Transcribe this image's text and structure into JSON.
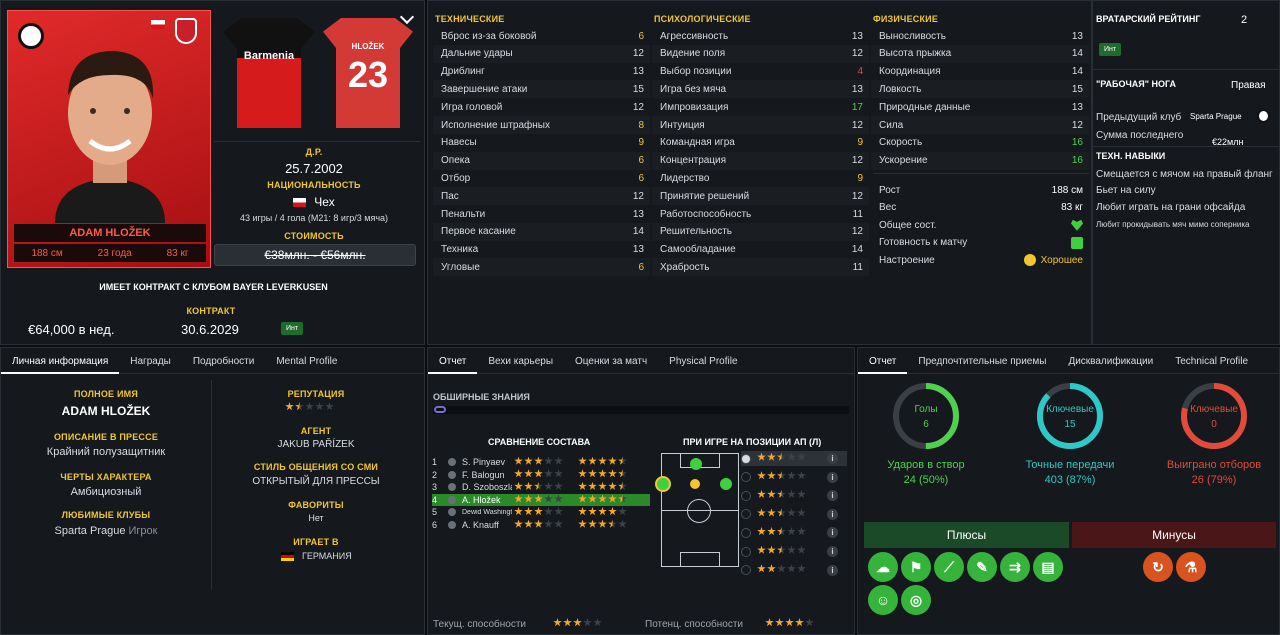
{
  "player": {
    "name_card": "ADAM HLOŽEK",
    "height": "188 см",
    "age": "23 года",
    "weight": "83 кг",
    "jersey_sponsor": "Barmenia",
    "jersey_name": "HLOŽEK",
    "jersey_number": "23",
    "dob_label": "Д.Р.",
    "dob": "25.7.2002",
    "nationality_label": "НАЦИОНАЛЬНОСТЬ",
    "nationality": "Чех",
    "caps": "43 игры / 4 гола (М21: 8 игр/3 мяча)",
    "value_label": "СТОИМОСТЬ",
    "value": "€38млн. - €56млн.",
    "contract_status": "ИМЕЕТ КОНТРАКТ С КЛУБОМ BAYER LEVERKUSEN",
    "contract_label": "КОНТРАКТ",
    "wage": "€64,000 в нед.",
    "contract_end": "30.6.2029",
    "int_badge": "Инт"
  },
  "attributes": {
    "technical_header": "ТЕХНИЧЕСКИЕ",
    "technical": [
      {
        "name": "Вброс из-за боковой",
        "value": "6",
        "color": "#f2c62f"
      },
      {
        "name": "Дальние удары",
        "value": "12",
        "color": "#d8dde2"
      },
      {
        "name": "Дриблинг",
        "value": "13",
        "color": "#d8dde2"
      },
      {
        "name": "Завершение атаки",
        "value": "15",
        "color": "#d8dde2"
      },
      {
        "name": "Игра головой",
        "value": "12",
        "color": "#d8dde2"
      },
      {
        "name": "Исполнение штрафных",
        "value": "8",
        "color": "#f2c62f"
      },
      {
        "name": "Навесы",
        "value": "9",
        "color": "#f2c62f"
      },
      {
        "name": "Опека",
        "value": "6",
        "color": "#f2c62f"
      },
      {
        "name": "Отбор",
        "value": "6",
        "color": "#f2c62f"
      },
      {
        "name": "Пас",
        "value": "12",
        "color": "#d8dde2"
      },
      {
        "name": "Пенальти",
        "value": "13",
        "color": "#d8dde2"
      },
      {
        "name": "Первое касание",
        "value": "14",
        "color": "#d8dde2"
      },
      {
        "name": "Техника",
        "value": "13",
        "color": "#d8dde2"
      },
      {
        "name": "Угловые",
        "value": "6",
        "color": "#f2c62f"
      }
    ],
    "mental_header": "ПСИХОЛОГИЧЕСКИЕ",
    "mental": [
      {
        "name": "Агрессивность",
        "value": "13",
        "color": "#d8dde2"
      },
      {
        "name": "Видение поля",
        "value": "12",
        "color": "#d8dde2"
      },
      {
        "name": "Выбор позиции",
        "value": "4",
        "color": "#e04b3c"
      },
      {
        "name": "Игра без мяча",
        "value": "13",
        "color": "#d8dde2"
      },
      {
        "name": "Импровизация",
        "value": "17",
        "color": "#4fd14f"
      },
      {
        "name": "Интуиция",
        "value": "12",
        "color": "#d8dde2"
      },
      {
        "name": "Командная игра",
        "value": "9",
        "color": "#f2c62f"
      },
      {
        "name": "Концентрация",
        "value": "12",
        "color": "#d8dde2"
      },
      {
        "name": "Лидерство",
        "value": "9",
        "color": "#f2c62f"
      },
      {
        "name": "Принятие решений",
        "value": "12",
        "color": "#d8dde2"
      },
      {
        "name": "Работоспособность",
        "value": "11",
        "color": "#d8dde2"
      },
      {
        "name": "Решительность",
        "value": "12",
        "color": "#d8dde2"
      },
      {
        "name": "Самообладание",
        "value": "14",
        "color": "#d8dde2"
      },
      {
        "name": "Храбрость",
        "value": "11",
        "color": "#d8dde2"
      }
    ],
    "physical_header": "ФИЗИЧЕСКИЕ",
    "physical": [
      {
        "name": "Выносливость",
        "value": "13",
        "color": "#d8dde2"
      },
      {
        "name": "Высота прыжка",
        "value": "14",
        "color": "#d8dde2"
      },
      {
        "name": "Координация",
        "value": "14",
        "color": "#d8dde2"
      },
      {
        "name": "Ловкость",
        "value": "15",
        "color": "#d8dde2"
      },
      {
        "name": "Природные данные",
        "value": "13",
        "color": "#d8dde2"
      },
      {
        "name": "Сила",
        "value": "12",
        "color": "#d8dde2"
      },
      {
        "name": "Скорость",
        "value": "16",
        "color": "#4fd14f"
      },
      {
        "name": "Ускорение",
        "value": "16",
        "color": "#4fd14f"
      }
    ],
    "body": [
      {
        "name": "Рост",
        "value": "188 см"
      },
      {
        "name": "Вес",
        "value": "83 кг"
      },
      {
        "name": "Общее сост.",
        "value": ""
      },
      {
        "name": "Готовность к матчу",
        "value": ""
      },
      {
        "name": "Настроение",
        "value": "Хорошее"
      }
    ]
  },
  "side": {
    "gk_rating_label": "ВРАТАРСКИЙ РЕЙТИНГ",
    "gk_rating": "2",
    "int_badge": "Инт",
    "foot_label": "\"РАБОЧАЯ\" НОГА",
    "foot": "Правая",
    "prev_club_label": "Предыдущий клуб",
    "prev_club": "Sparta Prague",
    "fee_label": "Сумма последнего",
    "fee": "€22млн",
    "skills_header": "ТЕХН. НАВЫКИ",
    "skills": [
      "Смещается с мячом на правый фланг",
      "Бьет на силу",
      "Любит играть на грани офсайда",
      "Любит прокидывать мяч мимо соперника"
    ]
  },
  "info_panel": {
    "tabs": [
      "Личная информация",
      "Награды",
      "Подробности",
      "Mental Profile"
    ],
    "fullname_label": "ПОЛНОЕ ИМЯ",
    "fullname": "ADAM HLOŽEK",
    "press_label": "ОПИСАНИЕ В ПРЕССЕ",
    "press": "Крайний полузащитник",
    "traits_label": "ЧЕРТЫ ХАРАКТЕРА",
    "traits": "Амбициозный",
    "fav_clubs_label": "ЛЮБИМЫЕ КЛУБЫ",
    "fav_club": "Sparta Prague",
    "fav_club_role": "Игрок",
    "reputation_label": "РЕПУТАЦИЯ",
    "reputation_stars": 1.5,
    "agent_label": "АГЕНТ",
    "agent": "JAKUB PAŘÍZEK",
    "media_label": "СТИЛЬ ОБЩЕНИЯ СО СМИ",
    "media": "ОТКРЫТЫЙ ДЛЯ ПРЕССЫ",
    "favs_label": "ФАВОРИТЫ",
    "favs": "Нет",
    "plays_in_label": "ИГРАЕТ В",
    "plays_in": "ГЕРМАНИЯ"
  },
  "report_panel": {
    "tabs": [
      "Отчет",
      "Вехи карьеры",
      "Оценки за матч",
      "Physical Profile"
    ],
    "knowledge_label": "ОБШИРНЫЕ ЗНАНИЯ",
    "squad_label": "СРАВНЕНИЕ СОСТАВА",
    "squad": [
      {
        "rank": "1",
        "name": "S. Pinyaev",
        "ca": 3,
        "pa": 4.5
      },
      {
        "rank": "2",
        "name": "F. Balogun",
        "ca": 3,
        "pa": 4.5
      },
      {
        "rank": "3",
        "name": "D. Szoboszlai",
        "ca": 2.5,
        "pa": 4.5
      },
      {
        "rank": "4",
        "name": "A. Hložek",
        "ca": 3,
        "pa": 4.5
      },
      {
        "rank": "5",
        "name": "Dewid Washington",
        "ca": 3,
        "pa": 4
      },
      {
        "rank": "6",
        "name": "A. Knauff",
        "ca": 3,
        "pa": 3.5
      }
    ],
    "position_label": "ПРИ ИГРЕ НА ПОЗИЦИИ АП (Л)",
    "role_stars": [
      2.5,
      2.5,
      2.5,
      2.5,
      2.5,
      2.5,
      2
    ],
    "ca_label": "Текущ. способности",
    "ca_stars": 3,
    "pa_label": "Потенц. способности",
    "pa_stars": 4
  },
  "stats_panel": {
    "tabs": [
      "Отчет",
      "Предпочтительные приемы",
      "Дисквалификации",
      "Technical Profile"
    ],
    "rings": [
      {
        "label": "Голы",
        "value": "6",
        "stat_label": "Ударов в створ",
        "stat": "24 (50%)",
        "color": "#4fd14f",
        "fill": 0.5
      },
      {
        "label": "Ключевые",
        "value": "15",
        "stat_label": "Точные передачи",
        "stat": "403 (87%)",
        "color": "#2fc7c7",
        "fill": 0.87
      },
      {
        "label": "Ключевые",
        "value": "0",
        "stat_label": "Выиграно отборов",
        "stat": "26 (79%)",
        "color": "#e04b3c",
        "fill": 0.79
      }
    ],
    "pros_label": "Плюсы",
    "cons_label": "Минусы"
  }
}
